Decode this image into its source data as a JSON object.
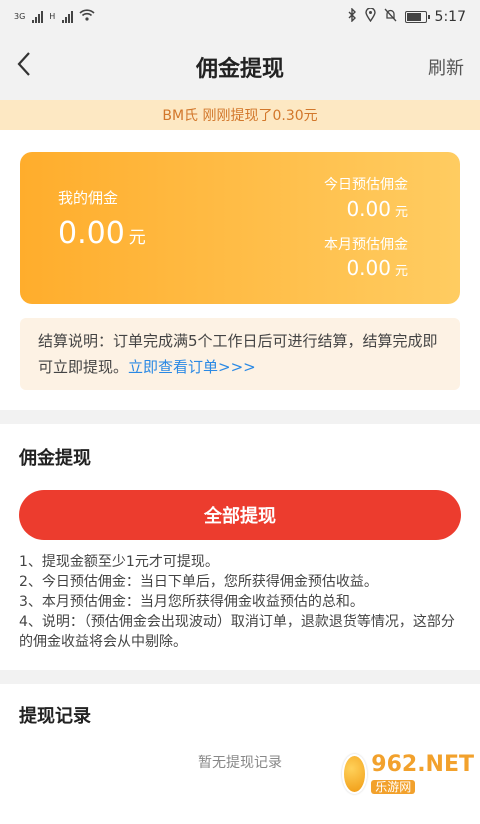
{
  "status_bar": {
    "network_left": "3G",
    "network_right": "H",
    "time": "5:17",
    "battery_level": 0.75
  },
  "header": {
    "back_icon": "back-chevron-icon",
    "title": "佣金提现",
    "refresh_label": "刷新"
  },
  "notice": {
    "text": "BM氏 刚刚提现了0.30元"
  },
  "card": {
    "my_commission_label": "我的佣金",
    "my_commission_value": "0.00",
    "unit": "元",
    "today_label": "今日预估佣金",
    "today_value": "0.00",
    "month_label": "本月预估佣金",
    "month_value": "0.00"
  },
  "settlement": {
    "text": "结算说明：订单完成满5个工作日后可进行结算，结算完成即可立即提现。",
    "link": "立即查看订单>>>"
  },
  "withdraw": {
    "section_title": "佣金提现",
    "button_label": "全部提现",
    "rules": [
      "1、提现金额至少1元才可提现。",
      "2、今日预估佣金：当日下单后，您所获得佣金预估收益。",
      "3、本月预估佣金：当月您所获得佣金收益预估的总和。",
      "4、说明：（预估佣金会出现波动）取消订单，退款退货等情况，这部分的佣金收益将会从中剔除。"
    ]
  },
  "records": {
    "section_title": "提现记录",
    "empty_text": "暂无提现记录"
  },
  "watermark": {
    "brand": "962.NET",
    "sub": "乐游网"
  }
}
